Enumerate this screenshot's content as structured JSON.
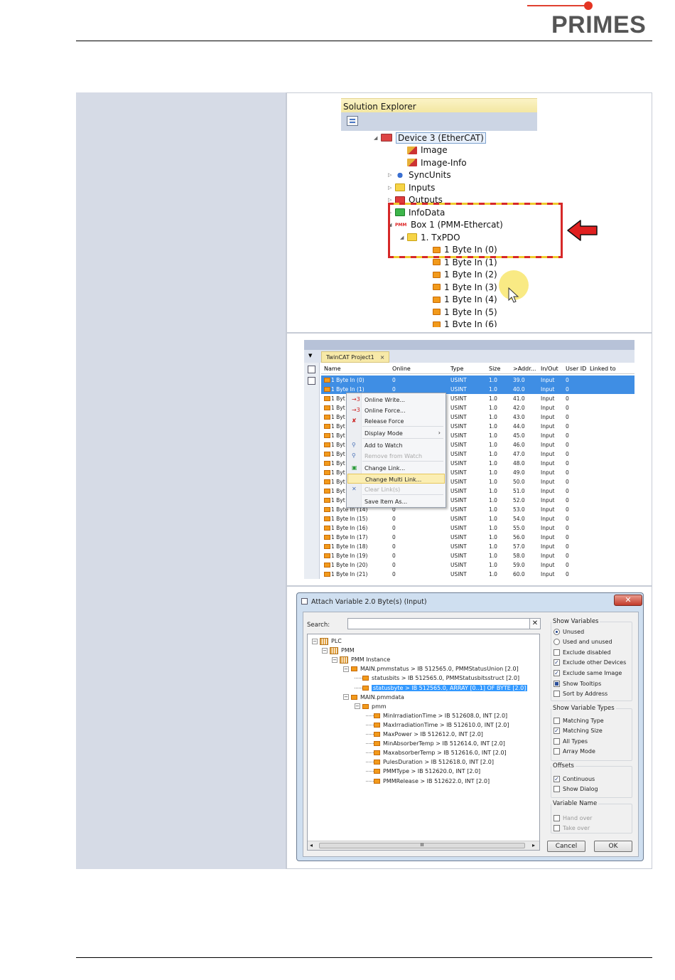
{
  "brand": {
    "name": "PRIMES",
    "accent": "#e43422"
  },
  "solution_explorer": {
    "title": "Solution Explorer",
    "items": [
      {
        "label": "Device 3 (EtherCAT)",
        "icon": "ethercat-device-icon",
        "expander": "◢"
      },
      {
        "label": "Image",
        "icon": "image-icon",
        "expander": ""
      },
      {
        "label": "Image-Info",
        "icon": "image-icon",
        "expander": ""
      },
      {
        "label": "SyncUnits",
        "icon": "sync-icon",
        "expander": "▷"
      },
      {
        "label": "Inputs",
        "icon": "folder-yellow-icon",
        "expander": "▷"
      },
      {
        "label": "Outputs",
        "icon": "folder-red-icon",
        "expander": "▷"
      },
      {
        "label": "InfoData",
        "icon": "folder-green-icon",
        "expander": "▷"
      },
      {
        "label": "Box 1 (PMM-Ethercat)",
        "icon": "pmm-box-icon",
        "icon_text": "PMM",
        "expander": "◢"
      },
      {
        "label": "1. TxPDO",
        "icon": "folder-yellow-icon",
        "expander": "◢"
      },
      {
        "label": "1 Byte In (0)",
        "icon": "variable-icon",
        "expander": ""
      },
      {
        "label": "1 Byte In (1)",
        "icon": "variable-icon",
        "expander": ""
      },
      {
        "label": "1 Byte In (2)",
        "icon": "variable-icon",
        "expander": ""
      },
      {
        "label": "1 Byte In (3)",
        "icon": "variable-icon",
        "expander": ""
      },
      {
        "label": "1 Byte In (4)",
        "icon": "variable-icon",
        "expander": ""
      },
      {
        "label": "1 Byte In (5)",
        "icon": "variable-icon",
        "expander": ""
      },
      {
        "label": "1 Byte In (6)",
        "icon": "variable-icon",
        "expander": ""
      }
    ]
  },
  "twincat": {
    "tab_label": "TwinCAT Project1",
    "tab_close": "×",
    "columns": [
      "Name",
      "Online",
      "Type",
      "Size",
      ">Addr...",
      "In/Out",
      "User ID",
      "Linked to"
    ],
    "rows": [
      {
        "name": "1 Byte In (0)",
        "online": "0",
        "type": "USINT",
        "size": "1.0",
        "addr": "39.0",
        "inout": "Input",
        "uid": "0",
        "selected": true
      },
      {
        "name": "1 Byte In (1)",
        "online": "0",
        "type": "USINT",
        "size": "1.0",
        "addr": "40.0",
        "inout": "Input",
        "uid": "0",
        "selected": true
      },
      {
        "name": "1 Byt",
        "online": "0",
        "type": "USINT",
        "size": "1.0",
        "addr": "41.0",
        "inout": "Input",
        "uid": "0",
        "selected": false
      },
      {
        "name": "1 Byt",
        "online": "0",
        "type": "USINT",
        "size": "1.0",
        "addr": "42.0",
        "inout": "Input",
        "uid": "0",
        "selected": false
      },
      {
        "name": "1 Byt",
        "online": "0",
        "type": "USINT",
        "size": "1.0",
        "addr": "43.0",
        "inout": "Input",
        "uid": "0",
        "selected": false
      },
      {
        "name": "1 Byt",
        "online": "0",
        "type": "USINT",
        "size": "1.0",
        "addr": "44.0",
        "inout": "Input",
        "uid": "0",
        "selected": false
      },
      {
        "name": "1 Byt",
        "online": "0",
        "type": "USINT",
        "size": "1.0",
        "addr": "45.0",
        "inout": "Input",
        "uid": "0",
        "selected": false
      },
      {
        "name": "1 Byt",
        "online": "0",
        "type": "USINT",
        "size": "1.0",
        "addr": "46.0",
        "inout": "Input",
        "uid": "0",
        "selected": false
      },
      {
        "name": "1 Byt",
        "online": "0",
        "type": "USINT",
        "size": "1.0",
        "addr": "47.0",
        "inout": "Input",
        "uid": "0",
        "selected": false
      },
      {
        "name": "1 Byt",
        "online": "0",
        "type": "USINT",
        "size": "1.0",
        "addr": "48.0",
        "inout": "Input",
        "uid": "0",
        "selected": false
      },
      {
        "name": "1 Byt",
        "online": "0",
        "type": "USINT",
        "size": "1.0",
        "addr": "49.0",
        "inout": "Input",
        "uid": "0",
        "selected": false
      },
      {
        "name": "1 Byt",
        "online": "0",
        "type": "USINT",
        "size": "1.0",
        "addr": "50.0",
        "inout": "Input",
        "uid": "0",
        "selected": false
      },
      {
        "name": "1 Byt",
        "online": "0",
        "type": "USINT",
        "size": "1.0",
        "addr": "51.0",
        "inout": "Input",
        "uid": "0",
        "selected": false
      },
      {
        "name": "1 Byt",
        "online": "0",
        "type": "USINT",
        "size": "1.0",
        "addr": "52.0",
        "inout": "Input",
        "uid": "0",
        "selected": false
      },
      {
        "name": "1 Byte In (14)",
        "online": "0",
        "type": "USINT",
        "size": "1.0",
        "addr": "53.0",
        "inout": "Input",
        "uid": "0",
        "selected": false
      },
      {
        "name": "1 Byte In (15)",
        "online": "0",
        "type": "USINT",
        "size": "1.0",
        "addr": "54.0",
        "inout": "Input",
        "uid": "0",
        "selected": false
      },
      {
        "name": "1 Byte In (16)",
        "online": "0",
        "type": "USINT",
        "size": "1.0",
        "addr": "55.0",
        "inout": "Input",
        "uid": "0",
        "selected": false
      },
      {
        "name": "1 Byte In (17)",
        "online": "0",
        "type": "USINT",
        "size": "1.0",
        "addr": "56.0",
        "inout": "Input",
        "uid": "0",
        "selected": false
      },
      {
        "name": "1 Byte In (18)",
        "online": "0",
        "type": "USINT",
        "size": "1.0",
        "addr": "57.0",
        "inout": "Input",
        "uid": "0",
        "selected": false
      },
      {
        "name": "1 Byte In (19)",
        "online": "0",
        "type": "USINT",
        "size": "1.0",
        "addr": "58.0",
        "inout": "Input",
        "uid": "0",
        "selected": false
      },
      {
        "name": "1 Byte In (20)",
        "online": "0",
        "type": "USINT",
        "size": "1.0",
        "addr": "59.0",
        "inout": "Input",
        "uid": "0",
        "selected": false
      },
      {
        "name": "1 Byte In (21)",
        "online": "0",
        "type": "USINT",
        "size": "1.0",
        "addr": "60.0",
        "inout": "Input",
        "uid": "0",
        "selected": false
      }
    ],
    "context_menu": [
      {
        "label": "Online Write...",
        "icon": "→3",
        "disabled": false,
        "highlight": false
      },
      {
        "label": "Online Force...",
        "icon": "→3",
        "disabled": false,
        "highlight": false
      },
      {
        "label": "Release Force",
        "icon": "✘",
        "disabled": false,
        "highlight": false
      },
      {
        "label": "Display Mode",
        "icon": "",
        "disabled": false,
        "highlight": false,
        "submenu": "›"
      },
      {
        "label": "Add to Watch",
        "icon": "⚲",
        "disabled": false,
        "highlight": false
      },
      {
        "label": "Remove from Watch",
        "icon": "⚲",
        "disabled": true,
        "highlight": false
      },
      {
        "label": "Change Link...",
        "icon": "▣",
        "disabled": false,
        "highlight": false
      },
      {
        "label": "Change Multi Link...",
        "icon": "",
        "disabled": false,
        "highlight": true
      },
      {
        "label": "Clear Link(s)",
        "icon": "✕",
        "disabled": true,
        "highlight": false
      },
      {
        "label": "Save Item As...",
        "icon": "",
        "disabled": false,
        "highlight": false
      }
    ]
  },
  "attach_dialog": {
    "title": "Attach Variable 2.0 Byte(s) (Input)",
    "close": "✕",
    "search_label": "Search:",
    "search_value": "",
    "search_clear": "✕",
    "tree": [
      {
        "label": "PLC",
        "icon": "plc-icon",
        "expander": "−"
      },
      {
        "label": "PMM",
        "icon": "plc-icon",
        "expander": "−"
      },
      {
        "label": "PMM Instance",
        "icon": "plc-icon",
        "expander": "−"
      },
      {
        "label": "MAIN.pmmstatus   >   IB 512565.0, PMMStatusUnion [2.0]",
        "icon": "variable-icon",
        "expander": "−"
      },
      {
        "label": "statusbits   >   IB 512565.0, PMMStatusbitsstruct [2.0]",
        "icon": "variable-icon",
        "expander": ""
      },
      {
        "label": "statusbyte   >   IB 512565.0, ARRAY [0..1] OF BYTE [2.0]",
        "icon": "variable-icon",
        "expander": "",
        "selected": true
      },
      {
        "label": "MAIN.pmmdata",
        "icon": "variable-icon",
        "expander": "−"
      },
      {
        "label": "pmm",
        "icon": "variable-icon",
        "expander": "−"
      },
      {
        "label": "MinIrradiationTime   >   IB 512608.0, INT [2.0]",
        "icon": "variable-icon",
        "expander": ""
      },
      {
        "label": "MaxIrradiationTime   >   IB 512610.0, INT [2.0]",
        "icon": "variable-icon",
        "expander": ""
      },
      {
        "label": "MaxPower   >   IB 512612.0, INT [2.0]",
        "icon": "variable-icon",
        "expander": ""
      },
      {
        "label": "MinAbsorberTemp   >   IB 512614.0, INT [2.0]",
        "icon": "variable-icon",
        "expander": ""
      },
      {
        "label": "MaxabsorberTemp   >   IB 512616.0, INT [2.0]",
        "icon": "variable-icon",
        "expander": ""
      },
      {
        "label": "PulesDuration   >   IB 512618.0, INT [2.0]",
        "icon": "variable-icon",
        "expander": ""
      },
      {
        "label": "PMMType   >   IB 512620.0, INT [2.0]",
        "icon": "variable-icon",
        "expander": ""
      },
      {
        "label": "PMMRelease   >   IB 512622.0, INT [2.0]",
        "icon": "variable-icon",
        "expander": ""
      }
    ],
    "scrollbar_grip": "III",
    "groups": {
      "show_variables": {
        "title": "Show Variables",
        "options": [
          {
            "label": "Unused",
            "kind": "radio",
            "checked": true,
            "disabled": false
          },
          {
            "label": "Used and unused",
            "kind": "radio",
            "checked": false,
            "disabled": false
          },
          {
            "label": "Exclude disabled",
            "kind": "check",
            "checked": false,
            "disabled": false
          },
          {
            "label": "Exclude other Devices",
            "kind": "check",
            "checked": true,
            "disabled": false
          },
          {
            "label": "Exclude same Image",
            "kind": "check",
            "checked": true,
            "disabled": false
          },
          {
            "label": "Show Tooltips",
            "kind": "check",
            "checked": "partial",
            "disabled": false
          },
          {
            "label": "Sort by Address",
            "kind": "check",
            "checked": false,
            "disabled": false
          }
        ]
      },
      "show_variable_types": {
        "title": "Show Variable Types",
        "options": [
          {
            "label": "Matching Type",
            "kind": "check",
            "checked": false,
            "disabled": false
          },
          {
            "label": "Matching Size",
            "kind": "check",
            "checked": true,
            "disabled": false
          },
          {
            "label": "All Types",
            "kind": "check",
            "checked": false,
            "disabled": false
          },
          {
            "label": "Array Mode",
            "kind": "check",
            "checked": false,
            "disabled": false
          }
        ]
      },
      "offsets": {
        "title": "Offsets",
        "options": [
          {
            "label": "Continuous",
            "kind": "check",
            "checked": true,
            "disabled": false
          },
          {
            "label": "Show Dialog",
            "kind": "check",
            "checked": false,
            "disabled": false
          }
        ]
      },
      "variable_name": {
        "title": "Variable Name",
        "options": [
          {
            "label": "Hand over",
            "kind": "check",
            "checked": false,
            "disabled": true
          },
          {
            "label": "Take over",
            "kind": "check",
            "checked": false,
            "disabled": true
          }
        ]
      }
    },
    "cancel_label": "Cancel",
    "ok_label": "OK"
  }
}
